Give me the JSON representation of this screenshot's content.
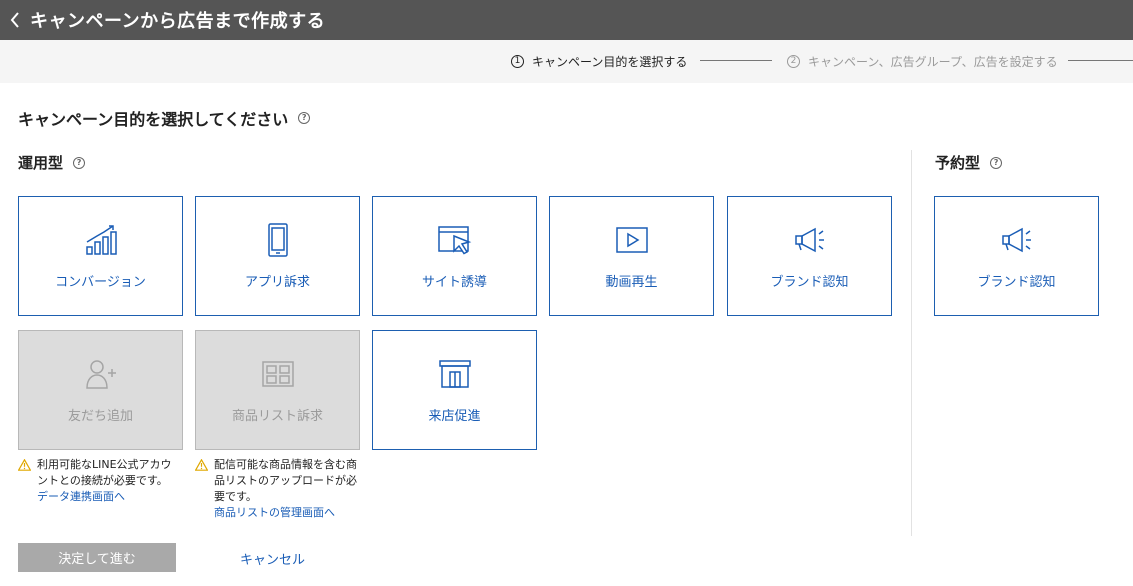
{
  "header": {
    "title": "キャンペーンから広告まで作成する"
  },
  "steps": [
    {
      "number": "1",
      "label": "キャンペーン目的を選択する"
    },
    {
      "number": "2",
      "label": "キャンペーン、広告グループ、広告を設定する"
    }
  ],
  "page_title": "キャンペーン目的を選択してください",
  "sections": {
    "operational": {
      "title": "運用型"
    },
    "reserved": {
      "title": "予約型"
    }
  },
  "cards": {
    "conversion": {
      "label": "コンバージョン",
      "icon": "bar-chart-growth-icon"
    },
    "app_appeal": {
      "label": "アプリ訴求",
      "icon": "smartphone-icon"
    },
    "site_traffic": {
      "label": "サイト誘導",
      "icon": "browser-cursor-icon"
    },
    "video_play": {
      "label": "動画再生",
      "icon": "video-play-icon"
    },
    "brand_awareness": {
      "label": "ブランド認知",
      "icon": "megaphone-icon"
    },
    "add_friends": {
      "label": "友だち追加",
      "icon": "add-user-icon"
    },
    "product_list": {
      "label": "商品リスト訴求",
      "icon": "product-grid-icon"
    },
    "store_visit": {
      "label": "来店促進",
      "icon": "storefront-icon"
    },
    "reserved_brand_awareness": {
      "label": "ブランド認知",
      "icon": "megaphone-icon"
    }
  },
  "notes": {
    "add_friends": {
      "line1": "利用可能なLINE公式アカウ",
      "line2": "ントとの接続が必要です。",
      "link": "データ連携画面へ"
    },
    "product_list": {
      "line1": "配信可能な商品情報を含む商",
      "line2": "品リストのアップロードが必",
      "line3": "要です。",
      "link": "商品リストの管理画面へ"
    }
  },
  "actions": {
    "confirm_label": "決定して進む",
    "cancel_label": "キャンセル"
  },
  "colors": {
    "header_bg": "#555555",
    "accent": "#1a5db6",
    "card_border": "#1d5fb0",
    "disabled_bg": "#dcdcdc",
    "warning": "#e0a800"
  }
}
